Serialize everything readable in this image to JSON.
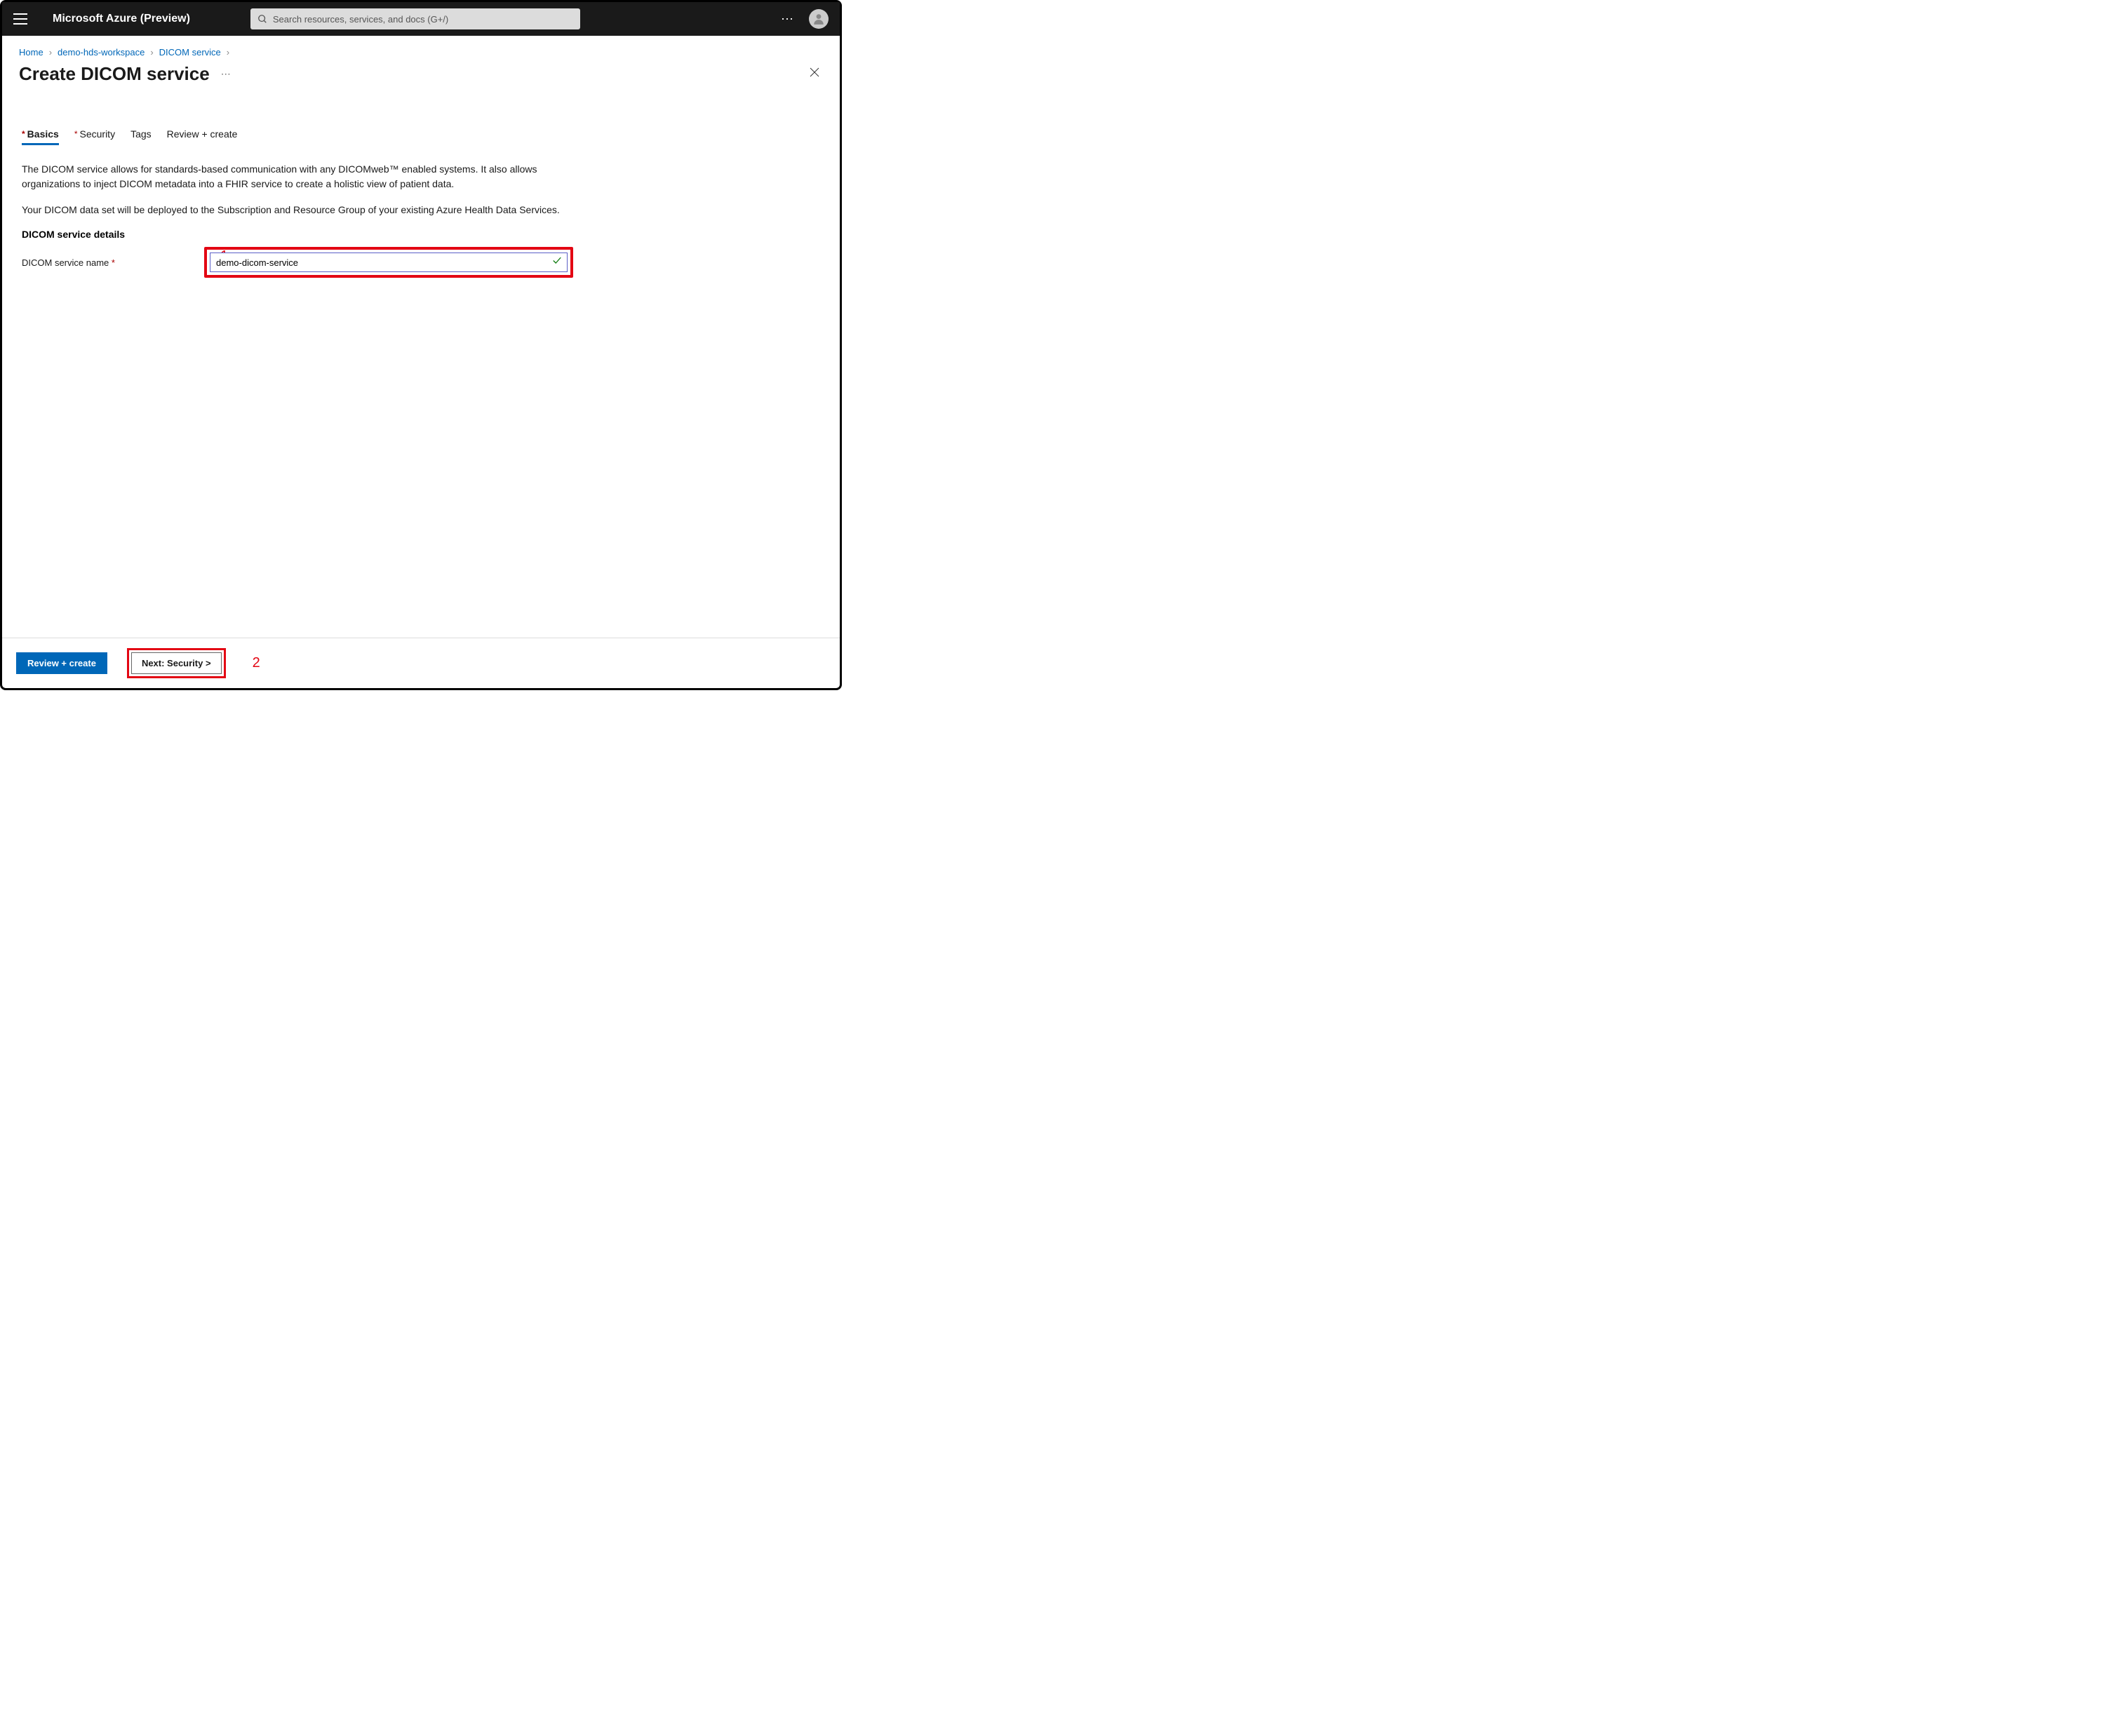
{
  "topbar": {
    "brand": "Microsoft Azure (Preview)",
    "search_placeholder": "Search resources, services, and docs (G+/)"
  },
  "breadcrumb": {
    "items": [
      "Home",
      "demo-hds-workspace",
      "DICOM service"
    ]
  },
  "page": {
    "title": "Create DICOM service"
  },
  "tabs": {
    "basics": "Basics",
    "security": "Security",
    "tags": "Tags",
    "review": "Review + create"
  },
  "description": {
    "p1": "The DICOM service allows for standards-based communication with any DICOMweb™ enabled systems. It also allows organizations to inject DICOM metadata into a FHIR service to create a holistic view of patient data.",
    "p2": "Your DICOM data set will be deployed to the Subscription and Resource Group of your existing Azure Health Data Services."
  },
  "form": {
    "section_title": "DICOM service details",
    "name_label": "DICOM service name",
    "name_value": "demo-dicom-service"
  },
  "footer": {
    "review_btn": "Review + create",
    "next_btn": "Next: Security >"
  },
  "annotations": {
    "one": "1",
    "two": "2"
  }
}
